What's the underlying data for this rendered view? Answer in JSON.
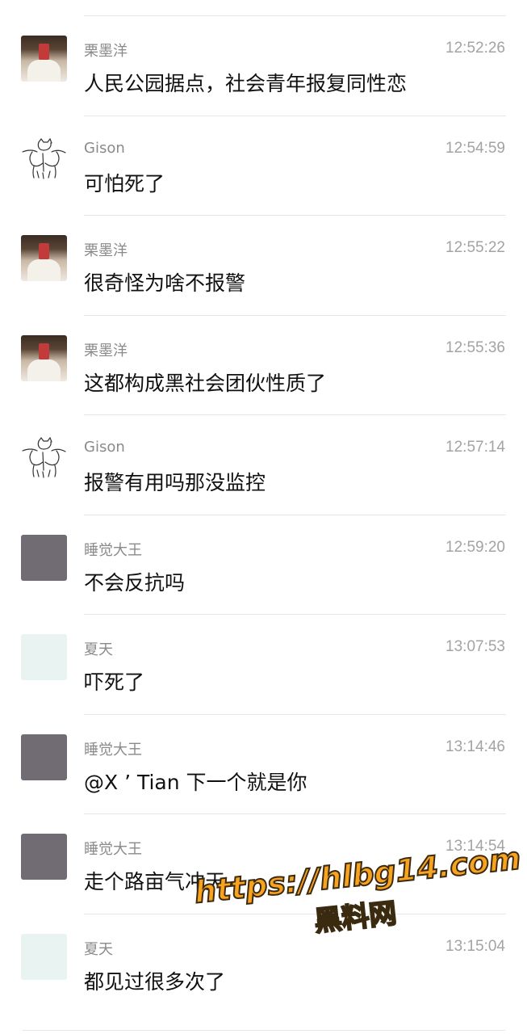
{
  "messages": [
    {
      "sender": "栗墨洋",
      "time": "12:52:26",
      "text": "人民公园据点，社会青年报复同性恋",
      "avatar": "photo"
    },
    {
      "sender": "Gison",
      "time": "12:54:59",
      "text": "可怕死了",
      "avatar": "sketch"
    },
    {
      "sender": "栗墨洋",
      "time": "12:55:22",
      "text": "很奇怪为啥不报警",
      "avatar": "photo"
    },
    {
      "sender": "栗墨洋",
      "time": "12:55:36",
      "text": "这都构成黑社会团伙性质了",
      "avatar": "photo"
    },
    {
      "sender": "Gison",
      "time": "12:57:14",
      "text": "报警有用吗那没监控",
      "avatar": "sketch"
    },
    {
      "sender": "睡觉大王",
      "time": "12:59:20",
      "text": "不会反抗吗",
      "avatar": "dark"
    },
    {
      "sender": "夏天",
      "time": "13:07:53",
      "text": "吓死了",
      "avatar": "light"
    },
    {
      "sender": "睡觉大王",
      "time": "13:14:46",
      "text": "@X ’ Tian 下一个就是你",
      "avatar": "dark"
    },
    {
      "sender": "睡觉大王",
      "time": "13:14:54",
      "text": "走个路亩气冲天",
      "avatar": "dark"
    },
    {
      "sender": "夏天",
      "time": "13:15:04",
      "text": "都见过很多次了",
      "avatar": "light"
    }
  ],
  "watermark": {
    "line1": "https://hlbg14.com",
    "line2": "黑料网"
  },
  "colors": {
    "avatar_dark": "#716b74",
    "avatar_light": "#e9f3f2",
    "watermark": "#f8a31f"
  }
}
